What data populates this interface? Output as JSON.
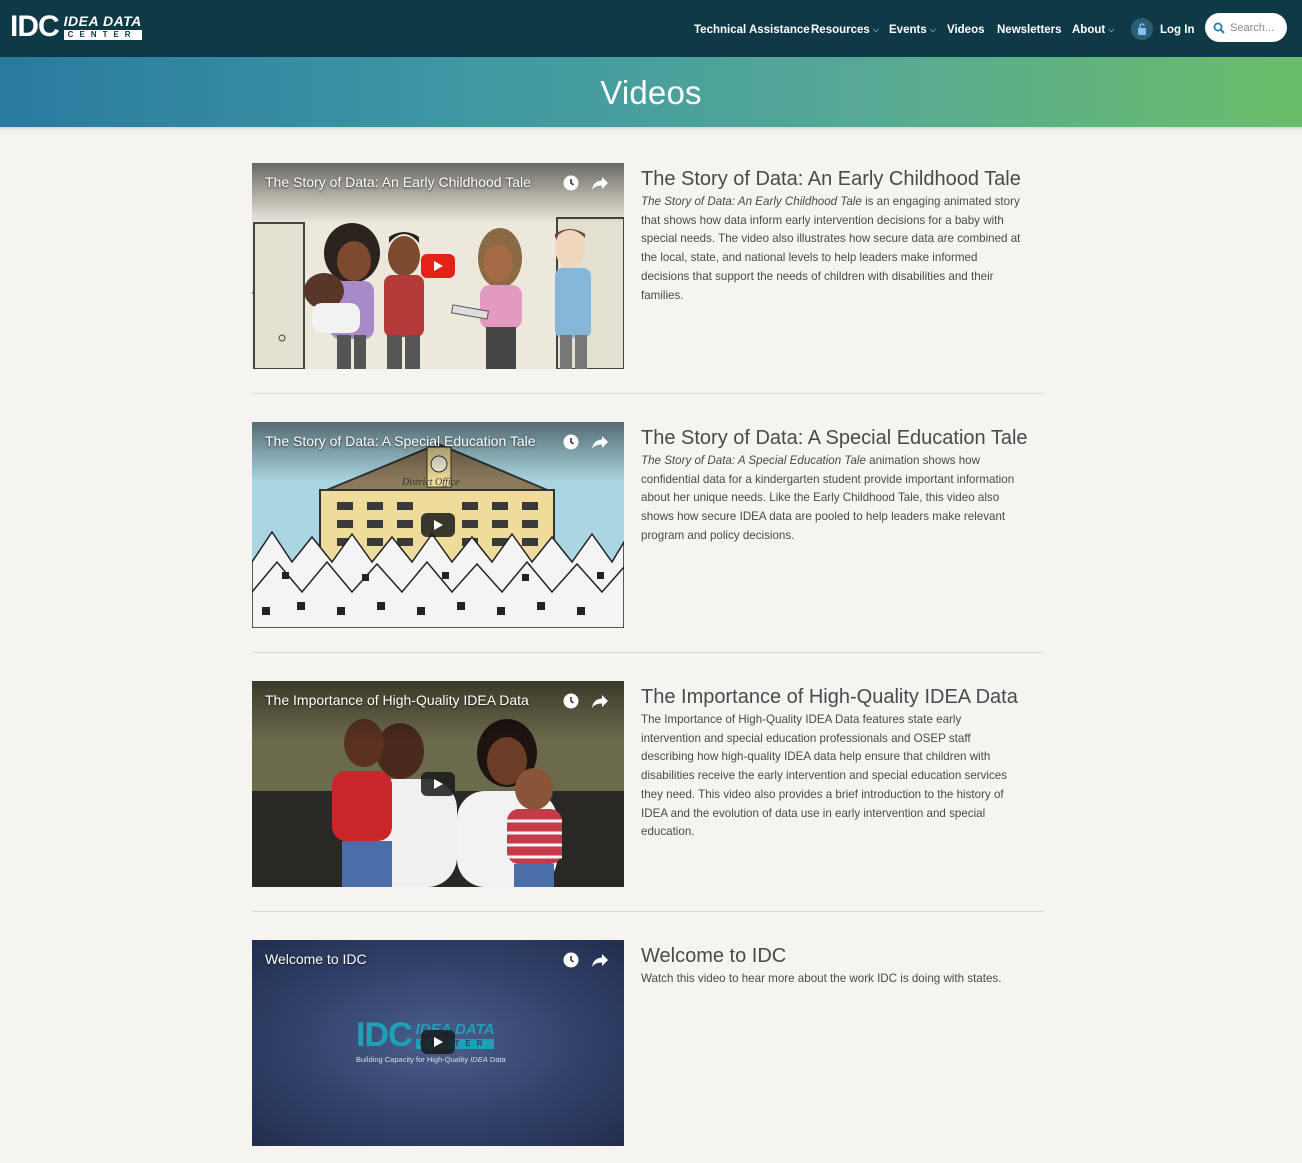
{
  "header": {
    "logo": {
      "mark": "IDC",
      "top": "IDEA DATA",
      "bottom": "CENTER"
    },
    "nav": [
      {
        "label": "Technical Assistance",
        "dropdown": false
      },
      {
        "label": "Resources",
        "dropdown": true
      },
      {
        "label": "Events",
        "dropdown": true
      },
      {
        "label": "Videos",
        "dropdown": false
      },
      {
        "label": "Newsletters",
        "dropdown": false
      },
      {
        "label": "About",
        "dropdown": true
      }
    ],
    "login_label": "Log In",
    "search_placeholder": "Search..."
  },
  "banner": {
    "title": "Videos"
  },
  "videos": [
    {
      "overlay_title": "The Story of Data: An Early Childhood Tale",
      "heading": "The Story of Data: An Early Childhood Tale",
      "desc_italic": "The Story of Data: An Early Childhood Tale",
      "desc_rest": " is an engaging animated story that shows how data inform early intervention decisions for a baby with special needs. The video also illustrates how secure data are combined at the local, state, and national levels to help leaders make informed decisions that support the needs of children with disabilities and their families."
    },
    {
      "overlay_title": "The Story of Data: A Special Education Tale",
      "heading": "The Story of Data: A Special Education Tale",
      "desc_italic": "The Story of Data: A Special Education Tale",
      "desc_rest": " animation shows how confidential data for a kindergarten student provide important information about her unique needs. Like the Early Childhood Tale, this video also shows how secure IDEA data are pooled to help leaders make relevant program and policy decisions.",
      "building_sign": "District Office"
    },
    {
      "overlay_title": "The Importance of High-Quality IDEA Data",
      "heading": "The Importance of High-Quality IDEA Data",
      "desc_italic": "",
      "desc_rest": "The Importance of High-Quality IDEA Data features state early intervention and special education professionals and OSEP staff describing how high-quality IDEA data help ensure that children with disabilities receive the early intervention and special education services they need. This video also provides a brief introduction to the history of IDEA and the evolution of data use in early intervention and special education."
    },
    {
      "overlay_title": "Welcome to IDC",
      "heading": "Welcome to IDC",
      "desc_italic": "",
      "desc_rest": "Watch this video to hear more about the work IDC is doing with states.",
      "inner_logo_mark": "IDC",
      "inner_logo_top": "IDEA DATA",
      "inner_logo_bottom": "CENTER",
      "inner_tagline_a": "Building Capacity for High-Quality ",
      "inner_tagline_b": "IDEA",
      "inner_tagline_c": " Data"
    }
  ],
  "colors": {
    "header_bg": "#0e3a47",
    "page_bg": "#f5f4f0",
    "banner_start": "#2a79a0",
    "banner_end": "#6abd68",
    "youtube_red": "#e62117"
  },
  "icons": [
    "search-icon",
    "lock-icon",
    "chevron-down-icon",
    "clock-icon",
    "share-icon",
    "play-icon"
  ]
}
